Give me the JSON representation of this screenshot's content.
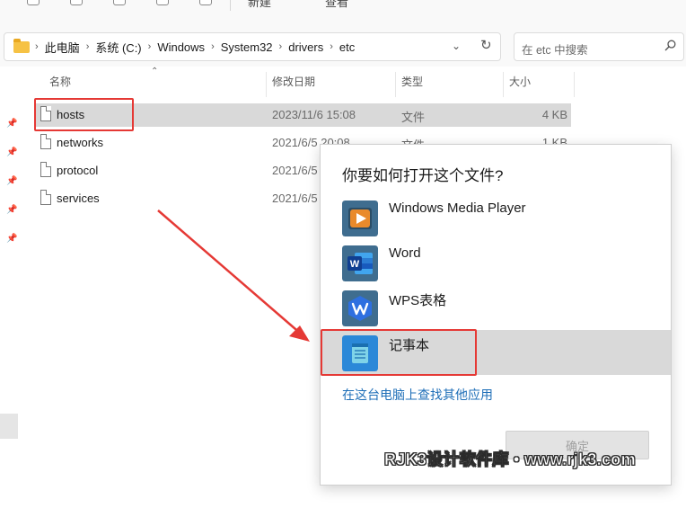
{
  "toolbar": {
    "partial_label_1": "新建",
    "partial_label_2": "查看"
  },
  "address": {
    "crumbs": [
      "此电脑",
      "系统 (C:)",
      "Windows",
      "System32",
      "drivers",
      "etc"
    ],
    "search_placeholder": "在 etc 中搜索"
  },
  "columns": {
    "name": "名称",
    "date": "修改日期",
    "type": "类型",
    "size": "大小"
  },
  "files": [
    {
      "name": "hosts",
      "date": "2023/11/6 15:08",
      "type": "文件",
      "size": "4 KB",
      "selected": true
    },
    {
      "name": "networks",
      "date": "2021/6/5 20:08",
      "type": "文件",
      "size": "1 KB",
      "selected": false
    },
    {
      "name": "protocol",
      "date": "2021/6/5",
      "type": "",
      "size": "",
      "selected": false
    },
    {
      "name": "services",
      "date": "2021/6/5",
      "type": "",
      "size": "",
      "selected": false
    }
  ],
  "dialog": {
    "title": "你要如何打开这个文件?",
    "apps": [
      {
        "label": "Windows Media Player",
        "icon": "windows-media-player-icon",
        "selected": false
      },
      {
        "label": "Word",
        "icon": "word-icon",
        "selected": false
      },
      {
        "label": "WPS表格",
        "icon": "wps-icon",
        "selected": false
      },
      {
        "label": "记事本",
        "icon": "notepad-icon",
        "selected": true
      }
    ],
    "more_link": "在这台电脑上查找其他应用",
    "ok_label": "确定"
  },
  "watermark": "RJK3设计软件库 • www.rjk3.com",
  "colors": {
    "highlight": "#e53935",
    "link": "#1f6fb8",
    "selection": "#d9d9d9"
  }
}
